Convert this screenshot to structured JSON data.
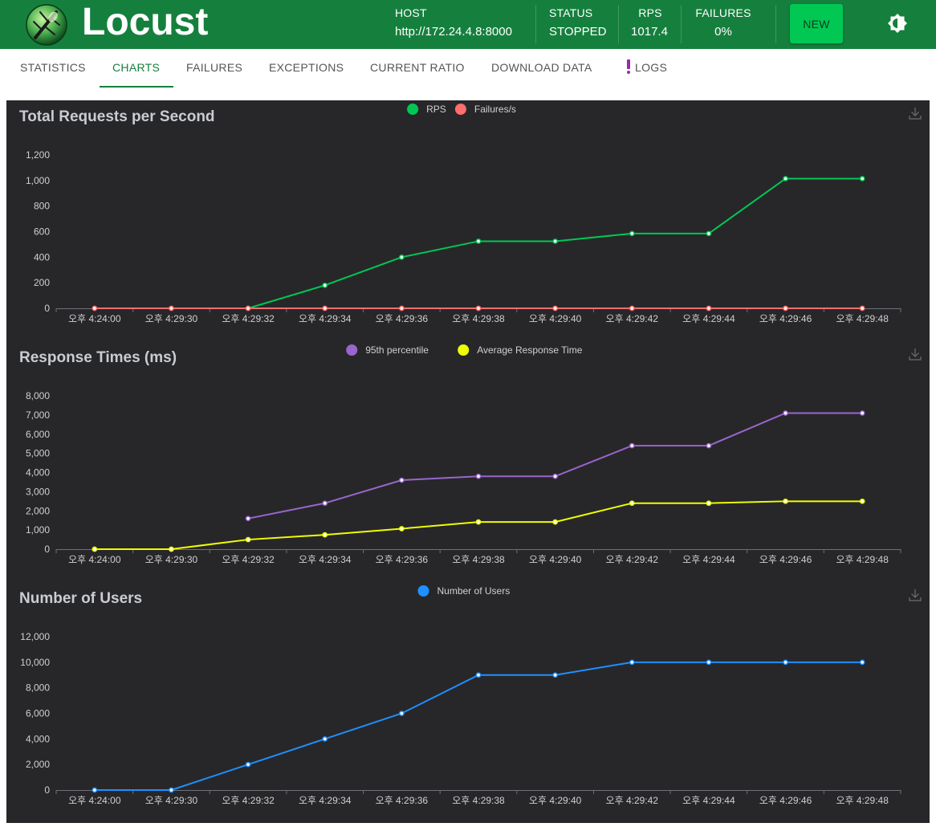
{
  "app": {
    "title": "Locust"
  },
  "header": {
    "host_label": "HOST",
    "host_value": "http://172.24.4.8:8000",
    "status_label": "STATUS",
    "status_value": "STOPPED",
    "rps_label": "RPS",
    "rps_value": "1017.4",
    "failures_label": "FAILURES",
    "failures_value": "0%",
    "new_button": "NEW",
    "theme_icon": "brightness-icon"
  },
  "tabs": [
    {
      "label": "STATISTICS",
      "active": false
    },
    {
      "label": "CHARTS",
      "active": true
    },
    {
      "label": "FAILURES",
      "active": false
    },
    {
      "label": "EXCEPTIONS",
      "active": false
    },
    {
      "label": "CURRENT RATIO",
      "active": false
    },
    {
      "label": "DOWNLOAD DATA",
      "active": false
    },
    {
      "label": "LOGS",
      "active": false,
      "icon": "exclamation-icon",
      "icon_color": "#9c27b0"
    }
  ],
  "colors": {
    "header_bg": "#15803d",
    "chart_bg": "#27272a",
    "accent": "#15803d"
  },
  "chart_data": [
    {
      "type": "line",
      "title": "Total Requests per Second",
      "x": [
        "오후 4:24:00",
        "오후 4:29:30",
        "오후 4:29:32",
        "오후 4:29:34",
        "오후 4:29:36",
        "오후 4:29:38",
        "오후 4:29:40",
        "오후 4:29:42",
        "오후 4:29:44",
        "오후 4:29:46",
        "오후 4:29:48"
      ],
      "ylim": [
        0,
        1200
      ],
      "yticks": [
        0,
        200,
        400,
        600,
        800,
        1000,
        1200
      ],
      "legend": "top-center",
      "series": [
        {
          "name": "RPS",
          "color": "#00c853",
          "values": [
            null,
            null,
            0,
            180,
            400,
            525,
            525,
            585,
            585,
            1015,
            1015
          ]
        },
        {
          "name": "Failures/s",
          "color": "#ff6d6d",
          "values": [
            0,
            0,
            0,
            0,
            0,
            0,
            0,
            0,
            0,
            0,
            0
          ]
        }
      ]
    },
    {
      "type": "line",
      "title": "Response Times (ms)",
      "x": [
        "오후 4:24:00",
        "오후 4:29:30",
        "오후 4:29:32",
        "오후 4:29:34",
        "오후 4:29:36",
        "오후 4:29:38",
        "오후 4:29:40",
        "오후 4:29:42",
        "오후 4:29:44",
        "오후 4:29:46",
        "오후 4:29:48"
      ],
      "ylim": [
        0,
        8000
      ],
      "yticks": [
        0,
        1000,
        2000,
        3000,
        4000,
        5000,
        6000,
        7000,
        8000
      ],
      "legend": "top-center",
      "series": [
        {
          "name": "95th percentile",
          "color": "#9966cc",
          "values": [
            null,
            null,
            1600,
            2400,
            3600,
            3800,
            3800,
            5400,
            5400,
            7100,
            7100
          ]
        },
        {
          "name": "Average Response Time",
          "color": "#eeff00",
          "values": [
            0,
            0,
            500,
            750,
            1070,
            1420,
            1420,
            2400,
            2400,
            2500,
            2500
          ]
        }
      ]
    },
    {
      "type": "line",
      "title": "Number of Users",
      "x": [
        "오후 4:24:00",
        "오후 4:29:30",
        "오후 4:29:32",
        "오후 4:29:34",
        "오후 4:29:36",
        "오후 4:29:38",
        "오후 4:29:40",
        "오후 4:29:42",
        "오후 4:29:44",
        "오후 4:29:46",
        "오후 4:29:48"
      ],
      "ylim": [
        0,
        12000
      ],
      "yticks": [
        0,
        2000,
        4000,
        6000,
        8000,
        10000,
        12000
      ],
      "legend": "top-center",
      "series": [
        {
          "name": "Number of Users",
          "color": "#1e90ff",
          "values": [
            0,
            0,
            2000,
            4000,
            6000,
            9000,
            9000,
            10000,
            10000,
            10000,
            10000
          ]
        }
      ]
    }
  ]
}
